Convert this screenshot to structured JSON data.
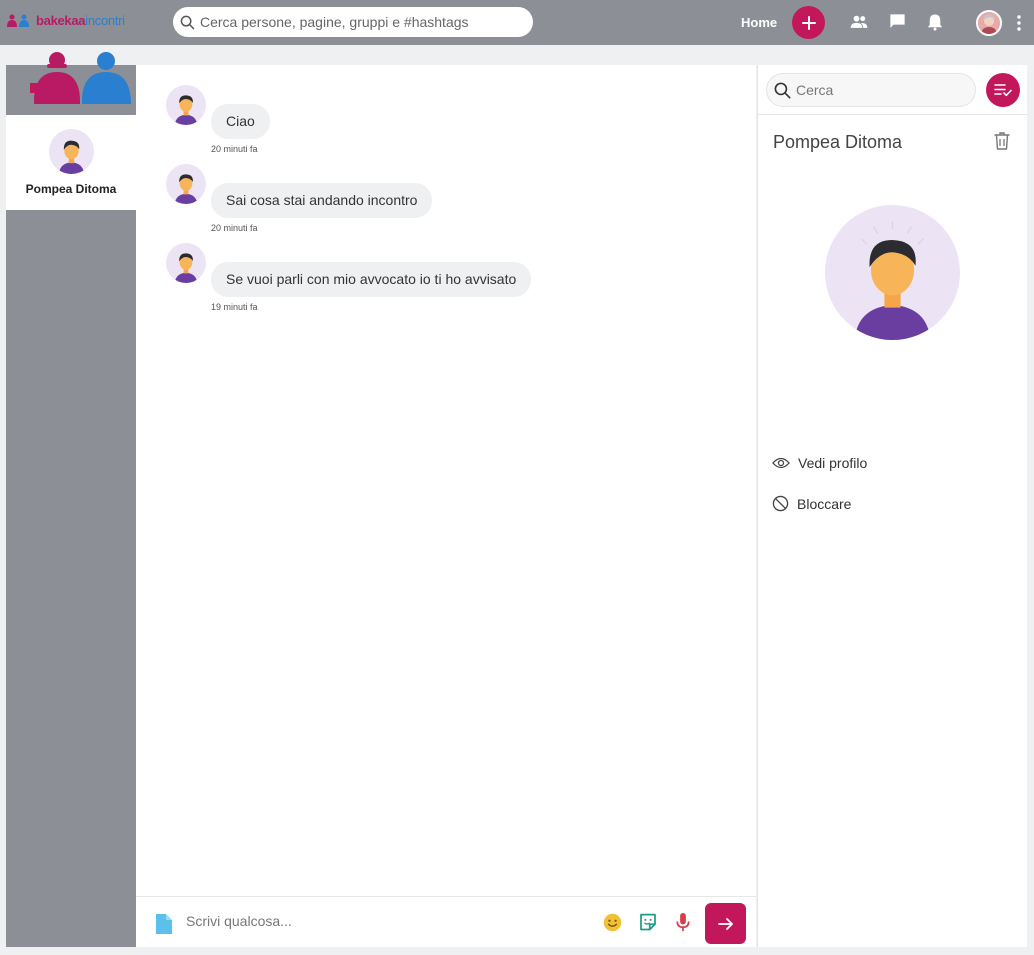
{
  "brand": {
    "part1": "bakekaa",
    "part2": "incontri"
  },
  "header": {
    "search_placeholder": "Cerca persone, pagine, gruppi e #hashtags",
    "home_label": "Home"
  },
  "conversations": [
    {
      "name": "Pompea Ditoma"
    }
  ],
  "chat": {
    "messages": [
      {
        "text": "Ciao",
        "time": "20 minuti fa"
      },
      {
        "text": "Sai cosa stai andando incontro",
        "time": "20 minuti fa"
      },
      {
        "text": "Se vuoi parli con mio avvocato io ti ho avvisato",
        "time": "19 minuti fa"
      }
    ],
    "composer_placeholder": "Scrivi qualcosa..."
  },
  "sidebar_right": {
    "search_placeholder": "Cerca",
    "contact_name": "Pompea Ditoma",
    "actions": [
      {
        "label": "Vedi profilo",
        "icon": "eye-icon"
      },
      {
        "label": "Bloccare",
        "icon": "block-icon"
      }
    ]
  },
  "colors": {
    "accent": "#c2185b",
    "topbar": "#8c9096",
    "bubble": "#eff0f1",
    "avatar_bg": "#ece4f4"
  }
}
